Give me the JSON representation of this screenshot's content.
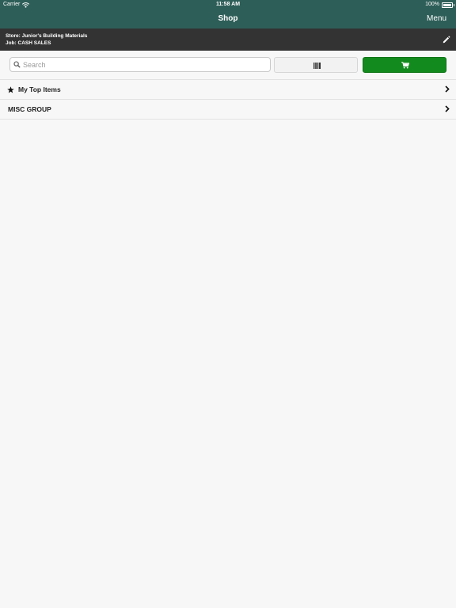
{
  "status_bar": {
    "carrier": "Carrier",
    "time": "11:58 AM",
    "battery": "100%",
    "battery_level": 1.0,
    "icons": [
      "wifi-icon",
      "battery-icon"
    ]
  },
  "nav": {
    "title": "Shop",
    "menu_label": "Menu"
  },
  "store_bar": {
    "store_line": "Store: Junior's Building Materials",
    "job_line": "Job: CASH SALES",
    "edit_icon": "pencil-icon"
  },
  "toolbar": {
    "search_placeholder": "Search",
    "search_value": "",
    "barcode_icon": "barcode-icon",
    "cart_icon": "cart-icon"
  },
  "list": {
    "items": [
      {
        "label": "My Top Items",
        "icon": "star-icon"
      },
      {
        "label": "MISC GROUP"
      }
    ]
  },
  "colors": {
    "nav_background": "#2e5e58",
    "store_bar_background": "#333333",
    "cart_button": "#138a1d",
    "page_background": "#f7f7f7"
  }
}
